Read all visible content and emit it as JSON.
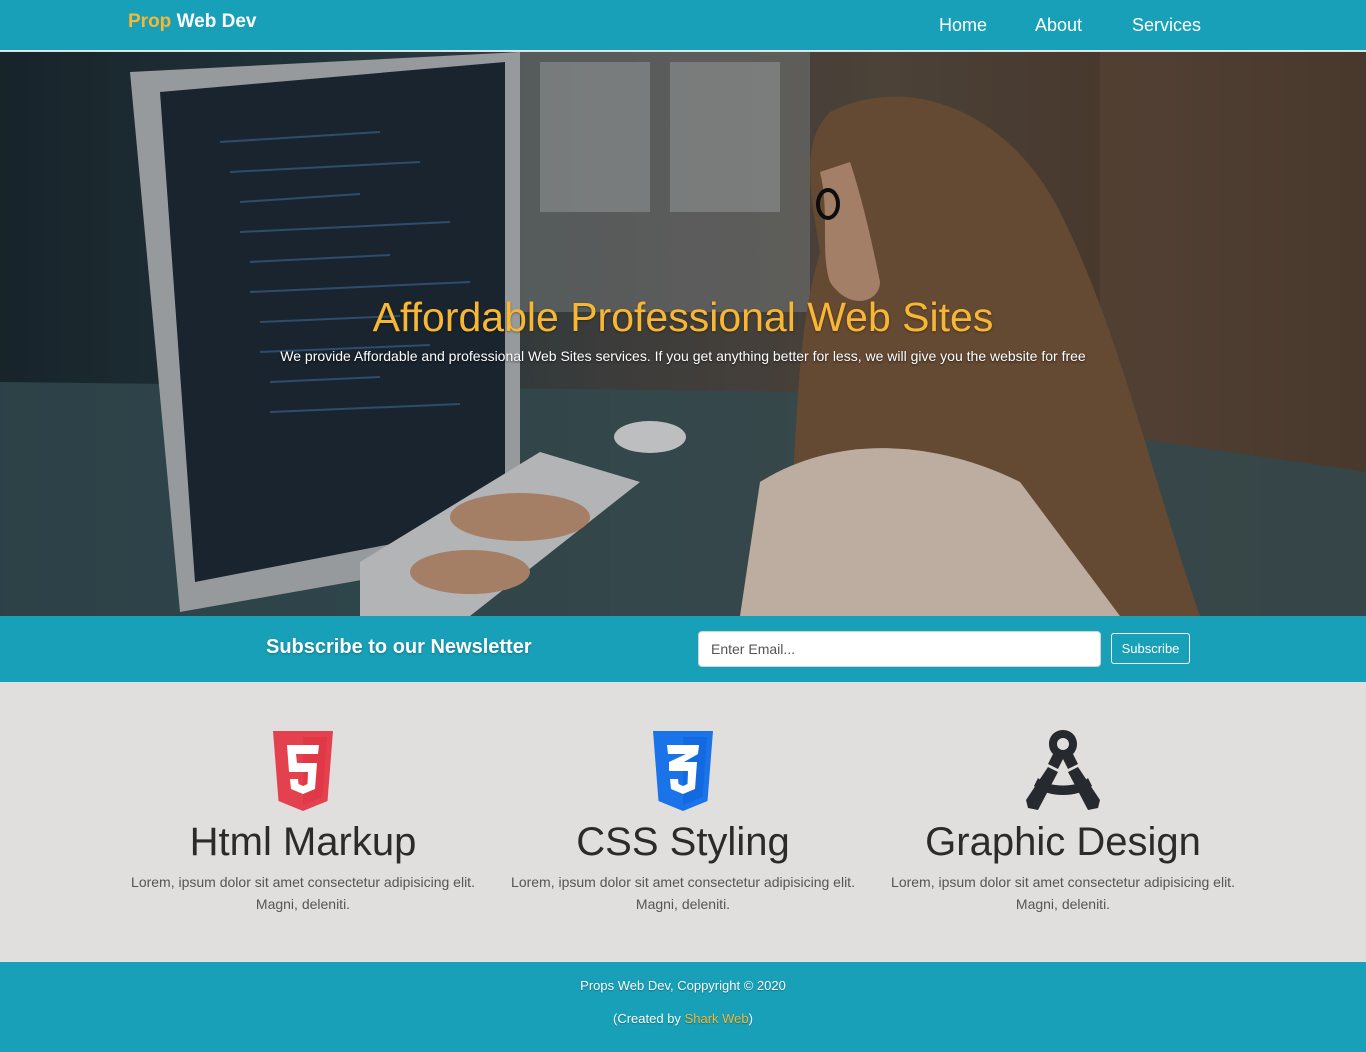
{
  "navbar": {
    "brand_accent": "Prop",
    "brand_rest": "Web Dev",
    "links": [
      "Home",
      "About",
      "Services"
    ]
  },
  "hero": {
    "title": "Affordable Professional Web Sites",
    "subtitle": "We provide Affordable and professional Web Sites services. If you get anything better for less, we will give you the website for free"
  },
  "newsletter": {
    "title": "Subscribe to our Newsletter",
    "email_placeholder": "Enter Email...",
    "button_label": "Subscribe"
  },
  "features": [
    {
      "icon": "html5-icon",
      "title": "Html Markup",
      "text": "Lorem, ipsum dolor sit amet consectetur adipisicing elit. Magni, deleniti."
    },
    {
      "icon": "css3-icon",
      "title": "CSS Styling",
      "text": "Lorem, ipsum dolor sit amet consectetur adipisicing elit. Magni, deleniti."
    },
    {
      "icon": "drafting-compass-icon",
      "title": "Graphic Design",
      "text": "Lorem, ipsum dolor sit amet consectetur adipisicing elit. Magni, deleniti."
    }
  ],
  "footer": {
    "copyright": "Props Web Dev, Coppyright © 2020",
    "created_prefix": "(Created by ",
    "created_link": "Shark Web",
    "created_suffix": ")"
  },
  "colors": {
    "primary": "#17a0b8",
    "accent": "#f7b733",
    "section_bg": "#e0dfde",
    "html5": "#e44d26",
    "css3": "#1572b6"
  }
}
